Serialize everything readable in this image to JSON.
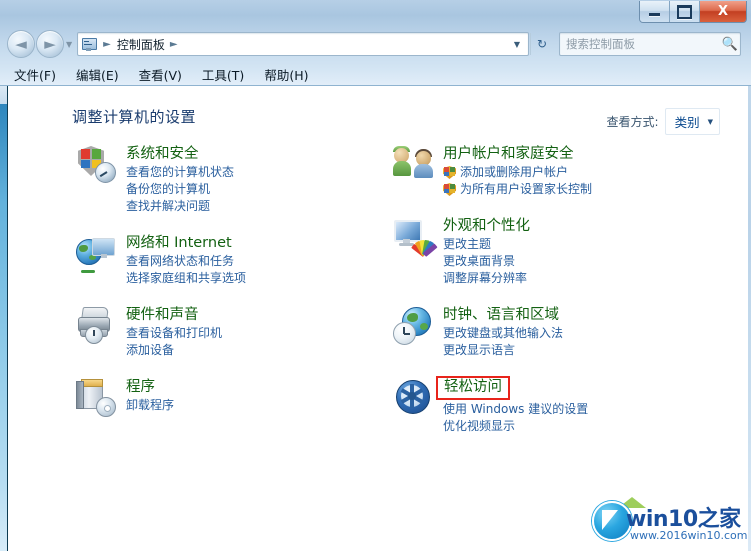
{
  "window": {
    "controls": {
      "minimize": "minimize-icon",
      "maximize": "maximize-icon",
      "close": "X"
    }
  },
  "nav": {
    "back_glyph": "◄",
    "forward_glyph": "►",
    "dropdown_glyph": "▼",
    "breadcrumb_icon": "control-panel-icon",
    "breadcrumb": "控制面板",
    "separator": "►",
    "address_dropdown": "▼",
    "refresh_glyph": "↻"
  },
  "search": {
    "placeholder": "搜索控制面板",
    "icon": "🔍"
  },
  "menubar": {
    "items": [
      {
        "label": "文件(F)"
      },
      {
        "label": "编辑(E)"
      },
      {
        "label": "查看(V)"
      },
      {
        "label": "工具(T)"
      },
      {
        "label": "帮助(H)"
      }
    ]
  },
  "page": {
    "heading": "调整计算机的设置"
  },
  "viewby": {
    "label": "查看方式:",
    "value": "类别",
    "caret": "▼"
  },
  "categories": {
    "left": [
      {
        "title": "系统和安全",
        "icon": "shield-gauge-icon",
        "links": [
          {
            "text": "查看您的计算机状态",
            "shield": false
          },
          {
            "text": "备份您的计算机",
            "shield": false
          },
          {
            "text": "查找并解决问题",
            "shield": false
          }
        ]
      },
      {
        "title": "网络和 Internet",
        "icon": "globe-monitor-icon",
        "links": [
          {
            "text": "查看网络状态和任务",
            "shield": false
          },
          {
            "text": "选择家庭组和共享选项",
            "shield": false
          }
        ]
      },
      {
        "title": "硬件和声音",
        "icon": "printer-icon",
        "links": [
          {
            "text": "查看设备和打印机",
            "shield": false
          },
          {
            "text": "添加设备",
            "shield": false
          }
        ]
      },
      {
        "title": "程序",
        "icon": "program-box-icon",
        "links": [
          {
            "text": "卸载程序",
            "shield": false
          }
        ]
      }
    ],
    "right": [
      {
        "title": "用户帐户和家庭安全",
        "icon": "users-icon",
        "links": [
          {
            "text": "添加或删除用户帐户",
            "shield": true
          },
          {
            "text": "为所有用户设置家长控制",
            "shield": true
          }
        ]
      },
      {
        "title": "外观和个性化",
        "icon": "monitor-palette-icon",
        "links": [
          {
            "text": "更改主题",
            "shield": false
          },
          {
            "text": "更改桌面背景",
            "shield": false
          },
          {
            "text": "调整屏幕分辨率",
            "shield": false
          }
        ]
      },
      {
        "title": "时钟、语言和区域",
        "icon": "globe-clock-icon",
        "links": [
          {
            "text": "更改键盘或其他输入法",
            "shield": false
          },
          {
            "text": "更改显示语言",
            "shield": false
          }
        ]
      },
      {
        "title": "轻松访问",
        "icon": "ease-of-access-icon",
        "highlighted": true,
        "links": [
          {
            "text": "使用 Windows 建议的设置",
            "shield": false
          },
          {
            "text": "优化视频显示",
            "shield": false
          }
        ]
      }
    ]
  },
  "watermark": {
    "title": "win10之家",
    "url": "www.2016win10.com"
  },
  "colors": {
    "category_title": "#136112",
    "link": "#2a5f9e",
    "heading": "#1a3c6e",
    "highlight_box": "#e8241b",
    "close_button": "#c33f22",
    "left_rail": "#63b2dc"
  }
}
